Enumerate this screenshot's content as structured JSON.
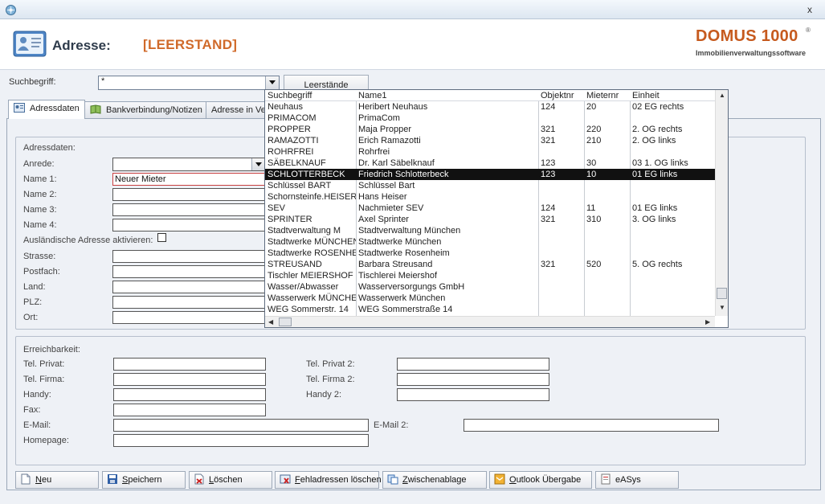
{
  "window": {
    "close_glyph": "x"
  },
  "header": {
    "title": "Adresse:",
    "status": "[LEERSTAND]"
  },
  "logo": {
    "main": "DOMUS 1000",
    "reg": "®",
    "sub": "Immobilienverwaltungssoftware"
  },
  "search": {
    "label": "Suchbegriff:",
    "value": "*",
    "leerstaende_button": "Leerstände"
  },
  "tabs": [
    {
      "label": "Adressdaten",
      "icon": "address-card-icon",
      "active": true
    },
    {
      "label": "Bankverbindung/Notizen",
      "icon": "book-icon",
      "active": false
    },
    {
      "label": "Adresse in Ver",
      "icon": "",
      "active": false
    }
  ],
  "address_group": {
    "title": "Adressdaten:",
    "anrede_label": "Anrede:",
    "name1_label": "Name 1:",
    "name1_value": "Neuer Mieter",
    "name2_label": "Name 2:",
    "name3_label": "Name 3:",
    "name4_label": "Name 4:",
    "foreign_label": "Ausländische Adresse aktivieren:",
    "street_label": "Strasse:",
    "postbox_label": "Postfach:",
    "country_label": "Land:",
    "zip_label": "PLZ:",
    "city_label": "Ort:"
  },
  "reach_group": {
    "title": "Erreichbarkeit:",
    "tel_private_label": "Tel. Privat:",
    "tel_firm_label": "Tel. Firma:",
    "mobile_label": "Handy:",
    "fax_label": "Fax:",
    "email_label": "E-Mail:",
    "homepage_label": "Homepage:",
    "tel_private2_label": "Tel. Privat 2:",
    "tel_firm2_label": "Tel. Firma 2:",
    "mobile2_label": "Handy 2:",
    "email2_label": "E-Mail 2:"
  },
  "buttons": [
    {
      "key": "neu",
      "ul": "N",
      "rest": "eu",
      "icon": "new-document-icon"
    },
    {
      "key": "speichern",
      "ul": "S",
      "rest": "peichern",
      "icon": "save-disk-icon"
    },
    {
      "key": "loeschen",
      "ul": "L",
      "rest": "öschen",
      "icon": "delete-icon"
    },
    {
      "key": "fehladressen",
      "ul": "F",
      "rest": "ehladressen löschen",
      "icon": "delete-addresses-icon"
    },
    {
      "key": "zwischenablage",
      "ul": "Z",
      "rest": "wischenablage",
      "icon": "clipboard-icon"
    },
    {
      "key": "outlook",
      "ul": "O",
      "rest": "utlook Übergabe",
      "icon": "outlook-icon"
    },
    {
      "key": "easys",
      "ul": "",
      "rest": "eASys",
      "icon": "easys-icon"
    }
  ],
  "dropdown": {
    "columns": [
      "Suchbegriff",
      "Name1",
      "Objektnr",
      "Mieternr",
      "Einheit"
    ],
    "rows": [
      [
        "Neuhaus",
        "Heribert Neuhaus",
        "124",
        "20",
        "02 EG rechts"
      ],
      [
        "PRIMACOM",
        "PrimaCom",
        "",
        "",
        ""
      ],
      [
        "PROPPER",
        "Maja Propper",
        "321",
        "220",
        "2. OG rechts"
      ],
      [
        "RAMAZOTTI",
        "Erich Ramazotti",
        "321",
        "210",
        "2. OG links"
      ],
      [
        "ROHRFREI",
        "Rohrfrei",
        "",
        "",
        ""
      ],
      [
        "SÄBELKNAUF",
        "Dr. Karl Säbelknauf",
        "123",
        "30",
        "03 1. OG links"
      ],
      [
        "SCHLOTTERBECK",
        "Friedrich Schlotterbeck",
        "123",
        "10",
        "01 EG links"
      ],
      [
        "Schlüssel BART",
        "Schlüssel Bart",
        "",
        "",
        ""
      ],
      [
        "Schornsteinfe.HEISER",
        "Hans Heiser",
        "",
        "",
        ""
      ],
      [
        "SEV",
        "Nachmieter SEV",
        "124",
        "11",
        "01 EG links"
      ],
      [
        "SPRINTER",
        "Axel Sprinter",
        "321",
        "310",
        "3. OG links"
      ],
      [
        "Stadtverwaltung M",
        "Stadtverwaltung München",
        "",
        "",
        ""
      ],
      [
        "Stadtwerke MÜNCHEN",
        "Stadtwerke München",
        "",
        "",
        ""
      ],
      [
        "Stadtwerke ROSENHEIM",
        "Stadtwerke Rosenheim",
        "",
        "",
        ""
      ],
      [
        "STREUSAND",
        "Barbara Streusand",
        "321",
        "520",
        "5. OG rechts"
      ],
      [
        "Tischler MEIERSHOF",
        "Tischlerei Meiershof",
        "",
        "",
        ""
      ],
      [
        "Wasser/Abwasser",
        "Wasserversorgungs GmbH",
        "",
        "",
        ""
      ],
      [
        "Wasserwerk MÜNCHEN",
        "Wasserwerk München",
        "",
        "",
        ""
      ],
      [
        "WEG Sommerstr. 14",
        "WEG Sommerstraße 14",
        "",
        "",
        ""
      ]
    ],
    "selected_suchbegriff": "SCHLOTTERBECK"
  },
  "colors": {
    "accent": "#d06a2a",
    "title": "#2e3b4b",
    "selection": "#111111"
  }
}
